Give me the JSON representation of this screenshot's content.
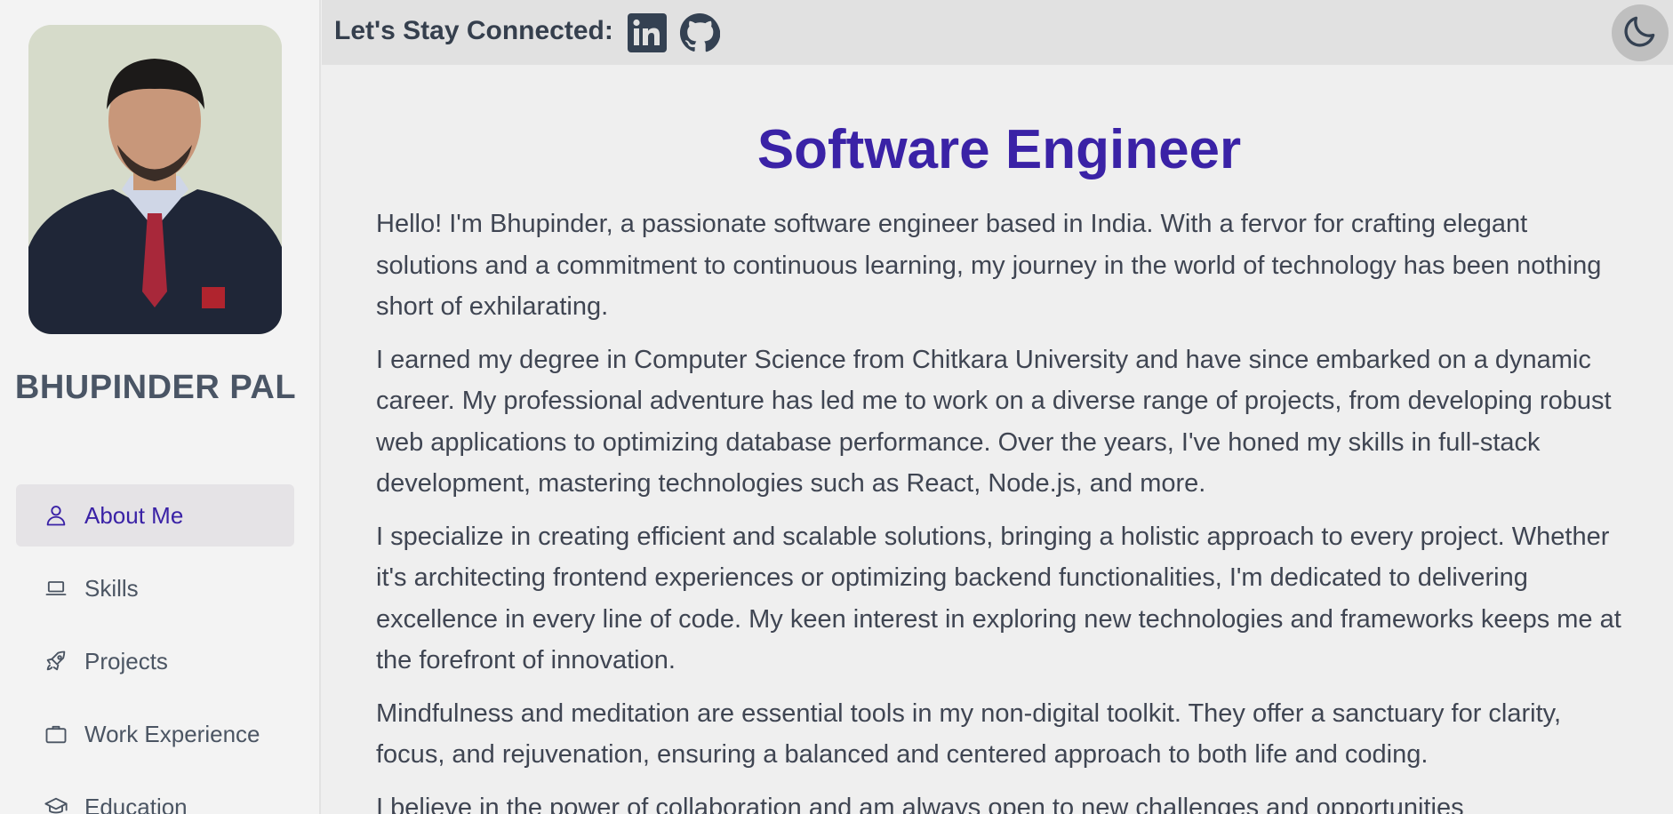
{
  "sidebar": {
    "name": "BHUPINDER PAL",
    "nav": [
      {
        "label": "About Me",
        "icon": "user-icon",
        "active": true
      },
      {
        "label": "Skills",
        "icon": "laptop-icon",
        "active": false
      },
      {
        "label": "Projects",
        "icon": "rocket-icon",
        "active": false
      },
      {
        "label": "Work Experience",
        "icon": "briefcase-icon",
        "active": false
      },
      {
        "label": "Education",
        "icon": "graduation-cap-icon",
        "active": false
      }
    ]
  },
  "topbar": {
    "connect_label": "Let's Stay Connected:",
    "social": [
      "linkedin-icon",
      "github-icon"
    ],
    "theme_toggle_icon": "moon-icon"
  },
  "main": {
    "headline": "Software Engineer",
    "paragraphs": [
      "Hello! I'm Bhupinder, a passionate software engineer based in India. With a fervor for crafting elegant solutions and a commitment to continuous learning, my journey in the world of technology has been nothing short of exhilarating.",
      "I earned my degree in Computer Science from Chitkara University and have since embarked on a dynamic career. My professional adventure has led me to work on a diverse range of projects, from developing robust web applications to optimizing database performance. Over the years, I've honed my skills in full-stack development, mastering technologies such as React, Node.js, and more.",
      "I specialize in creating efficient and scalable solutions, bringing a holistic approach to every project. Whether it's architecting frontend experiences or optimizing backend functionalities, I'm dedicated to delivering excellence in every line of code. My keen interest in exploring new technologies and frameworks keeps me at the forefront of innovation.",
      "Mindfulness and meditation are essential tools in my non-digital toolkit. They offer a sanctuary for clarity, focus, and rejuvenation, ensuring a balanced and centered approach to both life and coding.",
      "I believe in the power of collaboration and am always open to new challenges and opportunities"
    ]
  },
  "colors": {
    "accent": "#3a22a6",
    "text": "#3f4552",
    "sidebar_bg": "#f3f3f3",
    "topbar_bg": "#e1e1e1",
    "active_bg": "#e5e3e6"
  }
}
